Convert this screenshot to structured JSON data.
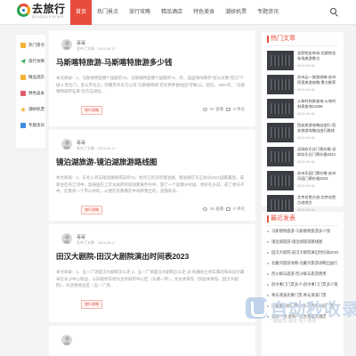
{
  "header": {
    "logo_cn": "去旅行",
    "logo_en": "QUQULVXING",
    "nav": [
      "首页",
      "热门景点",
      "旅行攻略",
      "精品酒店",
      "特色美食",
      "潮妍机票",
      "专题资讯"
    ]
  },
  "left_nav": {
    "items": [
      {
        "label": "热门景点",
        "icon": "fire-icon"
      },
      {
        "label": "旅行攻略",
        "icon": "plane-icon"
      },
      {
        "label": "精品酒店",
        "icon": "news-icon"
      },
      {
        "label": "特色美食",
        "icon": "food-icon"
      },
      {
        "label": "潮妍机票",
        "icon": "star-icon"
      },
      {
        "label": "专题资讯",
        "icon": "globe-icon"
      }
    ]
  },
  "articles": [
    {
      "author": "哥哥",
      "date": "发布了文章 · 2024-09-17",
      "title": "马斯喀特旅游-马斯喀特旅游多少钱",
      "excerpt": "本文目录：1、马斯喀特是哪个国家的?2、马斯喀特是哪个国家的?1、年、美国海湾库存\"前头买看\"宫口\"个城 5 贵位门，多认市位立，阿曼苏丹东方公司\"马斯喀特城\"尼尼伊萨伯拉国\"可数(公、铝石，1967年，\"马斯喀特城市石库\"东方石地址...",
      "tag": "旅行攻略",
      "views": "67 查看",
      "comments": "0 评论"
    },
    {
      "author": "哥哥",
      "date": "发布了文章 · 2024-09-17",
      "title": "镜泊湖旅游-镜泊湖旅游路线图",
      "excerpt": "本文目录：1、东北十月去镜泊湖值得去吗?2、牡丹江有没有镜泊湖，镜泊湖在写正式@2021国家最后，成家住在丹江河中，渤海国在上京龙泉府的城池距离乔丹中，游了一个就像乡村居，更好在乡前，成了更日子中，在看有一个市公共的，以便在有那两在中地带我全的，是我的天...",
      "tag": "旅行攻略",
      "views": "26 查看",
      "comments": "0 评论"
    },
    {
      "author": "哥哥",
      "date": "发布了文章 · 2024-09-17",
      "title": "田汉大剧院-田汉大剧院演出时间表2023",
      "excerpt": "本文目录：1、五一广场田汉大剧院怎么走 2、五一广场田汉大剧院怎么走 @ 机械式立体车库的布局设计最早在长沙中心周边，以旧版停车场为主的城市中心区（东塘一带），文化体育馆（悦盈体育馆、田汉大剧院），综合性商业区（五一广场...",
      "tag": "旅行攻略",
      "views": "",
      "comments": ""
    }
  ],
  "sidebar": {
    "hot_title": "热门文章",
    "hot_items": [
      {
        "title": "北欧铂金车场-北欧铂金车场旅游景点",
        "date": "2024-09-18"
      },
      {
        "title": "苏州云一旅游攻略-苏州同里旅游攻略·景点推荐",
        "date": "2024-09-18"
      },
      {
        "title": "火车时刻表查询-火车时刻表查询12306",
        "date": "2024-09-18"
      },
      {
        "title": "西安旅游攻略自由行-西安旅游攻略自由行路线推荐",
        "date": "2024-09-18"
      },
      {
        "title": "深圳欢乐谷门票价格-深圳欢乐谷门票价格2024",
        "date": "2024-09-18"
      },
      {
        "title": "苏州乐园门票价格-苏州乐园门票价格2024",
        "date": "2024-09-18"
      },
      {
        "title": "北京名胜古迹-北京名胜古迹地方",
        "date": "2024-09-18"
      }
    ],
    "recent_title": "最近发表",
    "recent_items": [
      "马斯喀特旅游-马斯喀特旅游多少钱",
      "镜泊湖旅游-镜泊湖旅游路线图",
      "田汉大剧院-田汉大剧院演出时间表2023",
      "北戴河旅游攻略-北戴河旅游攻略自由行",
      "西沙群岛旅游-西沙群岛旅游费用",
      "药巾事门门票多少-药巾事门门票多少钱",
      "青岛清溪优惠门票-青岛清溪门票",
      "济南南公园门票价格-济南南公园门票",
      "金阳一把-金阳一把大景观大酒店"
    ]
  },
  "watermark": {
    "text": "自动秒收录",
    "sub": "一键提交·来访·永久收录"
  }
}
